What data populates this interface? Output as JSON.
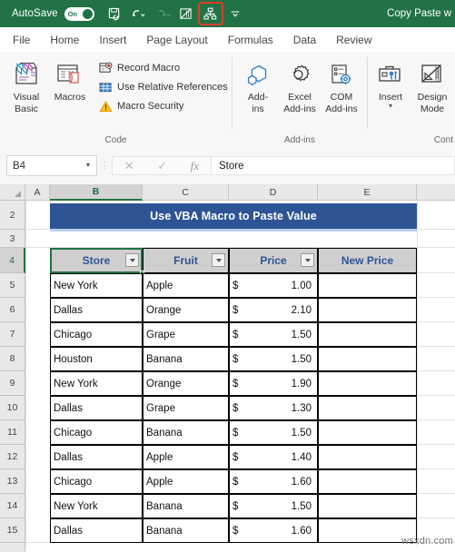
{
  "titlebar": {
    "autosave_label": "AutoSave",
    "autosave_state": "On",
    "document_title": "Copy Paste w",
    "qat": [
      {
        "name": "save-icon",
        "label": "Save"
      },
      {
        "name": "undo-icon",
        "label": "Undo"
      },
      {
        "name": "redo-icon",
        "label": "Redo"
      },
      {
        "name": "touch-mode-icon",
        "label": "Touch/Mouse Mode"
      },
      {
        "name": "hierarchy-icon",
        "label": "Hierarchy"
      },
      {
        "name": "customize-qat-icon",
        "label": "Customize Quick Access Toolbar"
      }
    ],
    "highlight_color": "#e13c2b",
    "bar_color": "#217346"
  },
  "tabs": [
    {
      "label": "File"
    },
    {
      "label": "Home"
    },
    {
      "label": "Insert"
    },
    {
      "label": "Page Layout"
    },
    {
      "label": "Formulas"
    },
    {
      "label": "Data"
    },
    {
      "label": "Review"
    }
  ],
  "ribbon": {
    "groups": [
      {
        "label": "Code",
        "big_buttons": [
          {
            "name": "visual-basic-button",
            "line1": "Visual",
            "line2": "Basic",
            "icon": "visual-basic-icon"
          },
          {
            "name": "macros-button",
            "line1": "Macros",
            "line2": "",
            "icon": "macros-icon"
          }
        ],
        "small_buttons": [
          {
            "name": "record-macro-button",
            "label": "Record Macro",
            "icon": "record-macro-icon"
          },
          {
            "name": "use-relative-references-button",
            "label": "Use Relative References",
            "icon": "relative-references-icon"
          },
          {
            "name": "macro-security-button",
            "label": "Macro Security",
            "icon": "warning-icon"
          }
        ]
      },
      {
        "label": "Add-ins",
        "big_buttons": [
          {
            "name": "add-ins-button",
            "line1": "Add-",
            "line2": "ins",
            "icon": "add-ins-icon"
          },
          {
            "name": "excel-add-ins-button",
            "line1": "Excel",
            "line2": "Add-ins",
            "icon": "excel-add-ins-icon"
          },
          {
            "name": "com-add-ins-button",
            "line1": "COM",
            "line2": "Add-ins",
            "icon": "com-add-ins-icon"
          }
        ],
        "small_buttons": []
      },
      {
        "label": "Cont",
        "big_buttons": [
          {
            "name": "insert-control-button",
            "line1": "Insert",
            "line2": "",
            "icon": "insert-control-icon",
            "dropdown": true
          },
          {
            "name": "design-mode-button",
            "line1": "Design",
            "line2": "Mode",
            "icon": "design-mode-icon"
          }
        ],
        "small_buttons": []
      }
    ]
  },
  "formula_bar": {
    "name_box_value": "B4",
    "cancel_icon": "cancel-icon",
    "confirm_icon": "confirm-icon",
    "fx_label": "fx",
    "formula_value": "Store"
  },
  "grid": {
    "column_headers": [
      "A",
      "B",
      "C",
      "D",
      "E"
    ],
    "selected_column": "B",
    "row_headers": [
      "2",
      "3",
      "4",
      "5",
      "6",
      "7",
      "8",
      "9",
      "10",
      "11",
      "12",
      "13",
      "14",
      "15"
    ],
    "selected_row": "4",
    "banner_title": "Use VBA Macro to Paste Value",
    "banner_color": "#2e5496",
    "table": {
      "headers": [
        {
          "label": "Store",
          "filter": true
        },
        {
          "label": "Fruit",
          "filter": true
        },
        {
          "label": "Price",
          "filter": true
        },
        {
          "label": "New Price",
          "filter": false
        }
      ],
      "header_bg": "#d0cece",
      "header_color": "#2e5496",
      "rows": [
        {
          "store": "New York",
          "fruit": "Apple",
          "currency": "$",
          "price": "1.00",
          "new_price": ""
        },
        {
          "store": "Dallas",
          "fruit": "Orange",
          "currency": "$",
          "price": "2.10",
          "new_price": ""
        },
        {
          "store": "Chicago",
          "fruit": "Grape",
          "currency": "$",
          "price": "1.50",
          "new_price": ""
        },
        {
          "store": "Houston",
          "fruit": "Banana",
          "currency": "$",
          "price": "1.50",
          "new_price": ""
        },
        {
          "store": "New York",
          "fruit": "Orange",
          "currency": "$",
          "price": "1.90",
          "new_price": ""
        },
        {
          "store": "Dallas",
          "fruit": "Grape",
          "currency": "$",
          "price": "1.30",
          "new_price": ""
        },
        {
          "store": "Chicago",
          "fruit": "Banana",
          "currency": "$",
          "price": "1.50",
          "new_price": ""
        },
        {
          "store": "Dallas",
          "fruit": "Apple",
          "currency": "$",
          "price": "1.40",
          "new_price": ""
        },
        {
          "store": "Chicago",
          "fruit": "Apple",
          "currency": "$",
          "price": "1.60",
          "new_price": ""
        },
        {
          "store": "New York",
          "fruit": "Banana",
          "currency": "$",
          "price": "1.50",
          "new_price": ""
        },
        {
          "store": "Dallas",
          "fruit": "Banana",
          "currency": "$",
          "price": "1.60",
          "new_price": ""
        }
      ]
    }
  },
  "watermark": "wsxdn.com"
}
